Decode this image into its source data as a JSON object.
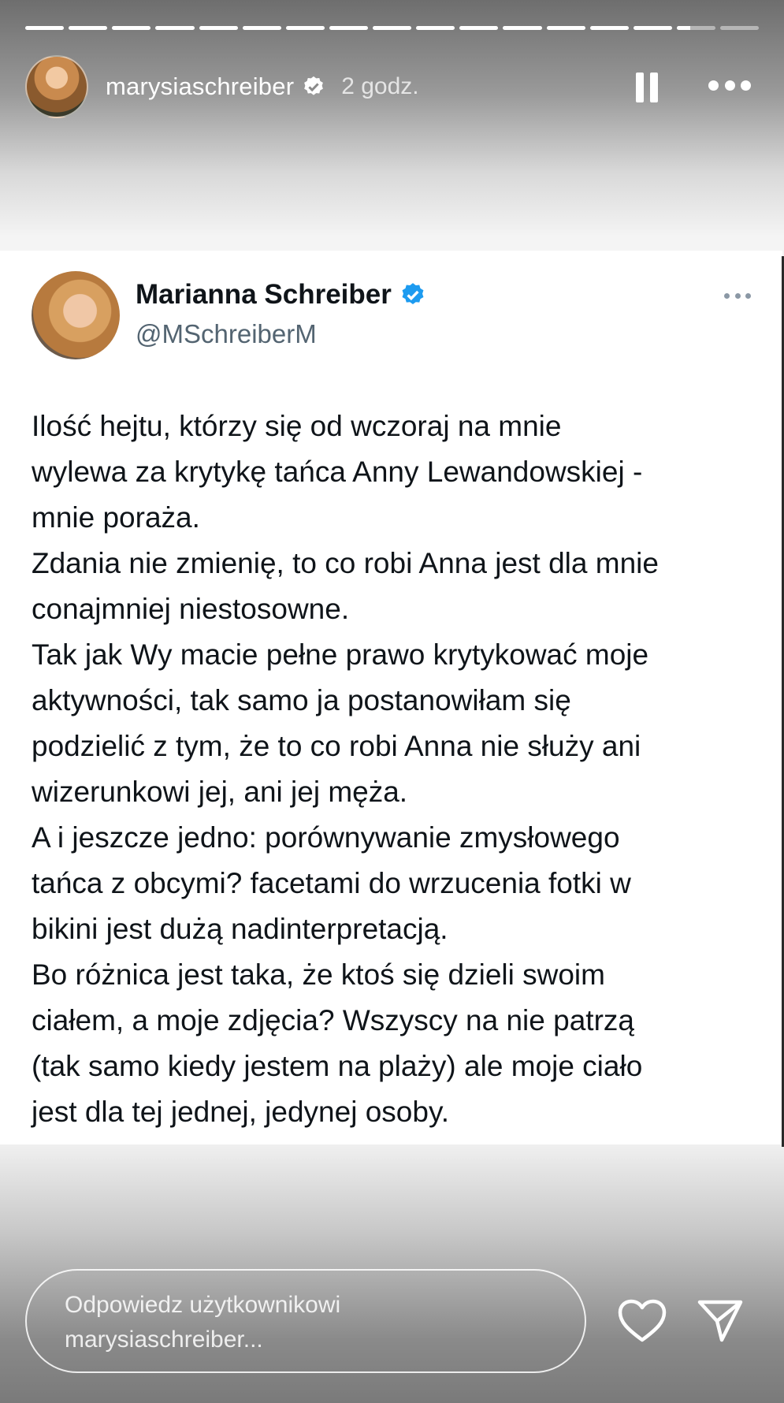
{
  "story": {
    "segments_total": 17,
    "segments_completed": 15,
    "current_segment_progress": 0.35,
    "username": "marysiaschreiber",
    "time": "2 godz.",
    "icons": {
      "verified": "verified-badge-icon",
      "pause": "pause-icon",
      "more": "more-icon"
    }
  },
  "tweet": {
    "name": "Marianna Schreiber",
    "handle": "@MSchreiberM",
    "text": "Ilość hejtu, którzy się od wczoraj na mnie\nwylewa za krytykę tańca Anny Lewandowskiej -\nmnie poraża.\nZdania nie zmienię, to co robi Anna jest dla mnie\nconajmniej niestosowne.\nTak jak Wy macie pełne prawo krytykować moje\naktywności, tak samo ja postanowiłam się\npodzielić z tym, że to co robi Anna nie służy ani\nwizerunkowi jej, ani jej męża.\nA i jeszcze jedno: porównywanie zmysłowego\ntańca z obcymi? facetami do wrzucenia fotki w\nbikini jest dużą nadinterpretacją.\nBo różnica jest taka, że ktoś się dzieli swoim\nciałem, a moje zdjęcia? Wszyscy na nie patrzą\n(tak samo kiedy jestem na plaży) ale moje ciało\njest dla tej jednej, jedynej osoby.",
    "verified_color": "#1d9bf0"
  },
  "reply": {
    "placeholder": "Odpowiedz użytkownikowi\nmarysiaschreiber...",
    "icons": {
      "like": "heart-icon",
      "send": "send-icon"
    }
  }
}
